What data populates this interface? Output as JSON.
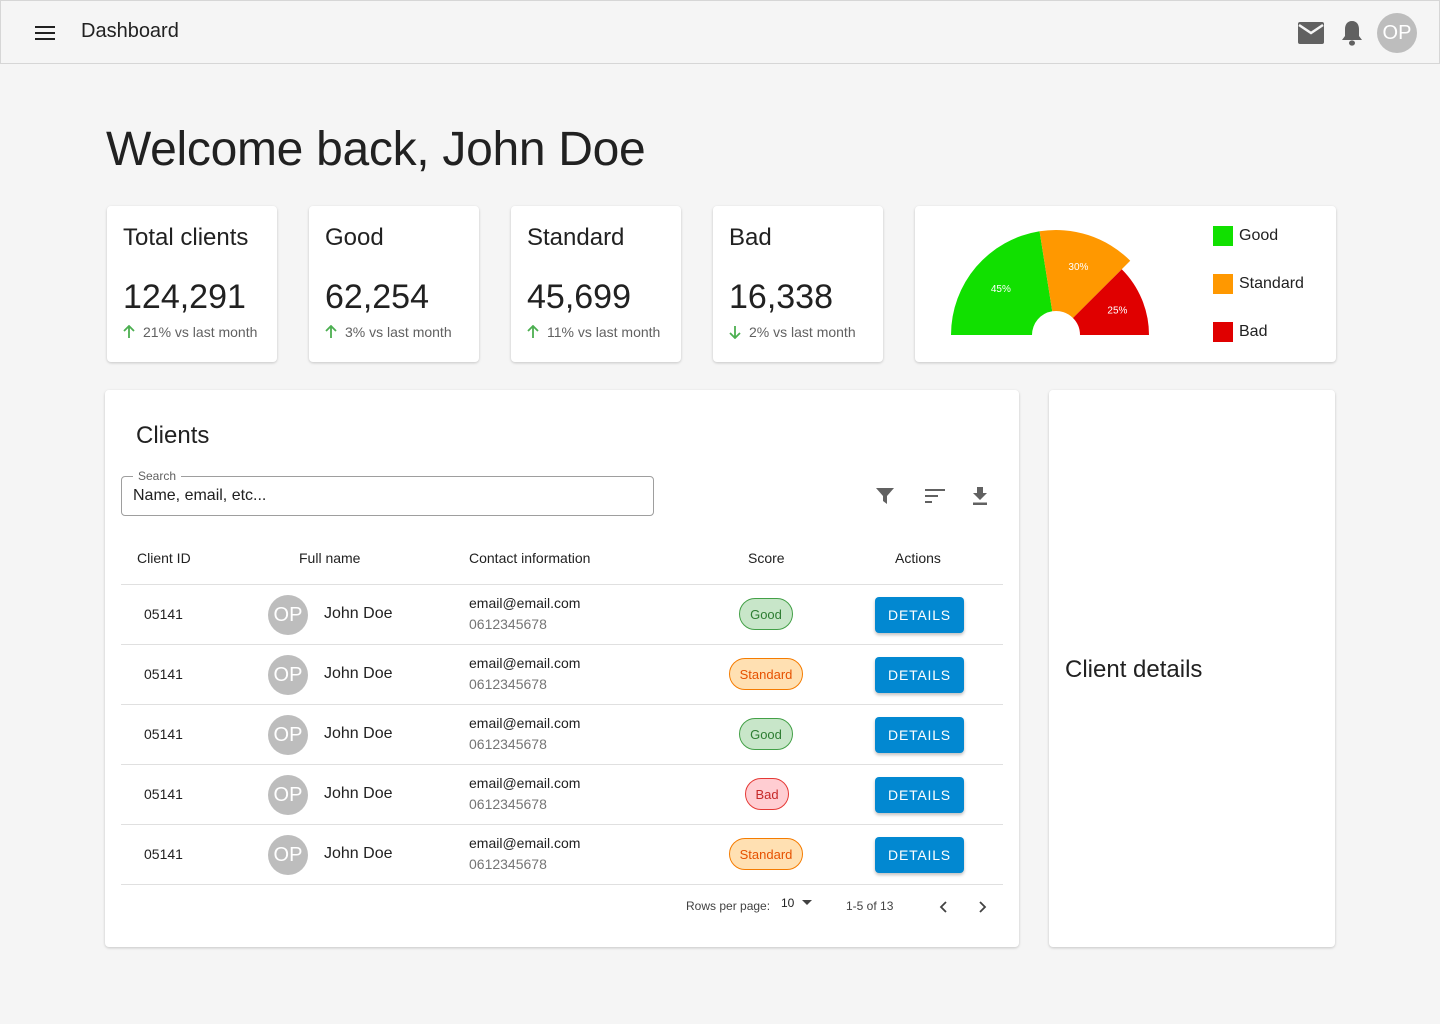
{
  "header": {
    "title": "Dashboard",
    "avatar_initials": "OP",
    "icons": [
      "menu-icon",
      "mail-icon",
      "bell-icon"
    ]
  },
  "welcome": "Welcome back, John Doe",
  "stats": [
    {
      "title": "Total clients",
      "value": "124,291",
      "trend": "21% vs last month",
      "direction": "up",
      "trend_color": "#4caf50"
    },
    {
      "title": "Good",
      "value": "62,254",
      "trend": "3% vs last month",
      "direction": "up",
      "trend_color": "#4caf50"
    },
    {
      "title": "Standard",
      "value": "45,699",
      "trend": "11% vs last month",
      "direction": "up",
      "trend_color": "#4caf50"
    },
    {
      "title": "Bad",
      "value": "16,338",
      "trend": "2% vs last month",
      "direction": "down",
      "trend_color": "#4caf50"
    }
  ],
  "chart_data": {
    "type": "pie",
    "variant": "half-donut",
    "categories": [
      "Good",
      "Standard",
      "Bad"
    ],
    "values": [
      45,
      30,
      25
    ],
    "labels": [
      "45%",
      "30%",
      "25%"
    ],
    "colors": [
      "#11e000",
      "#ff9800",
      "#e00000"
    ],
    "legend_position": "right"
  },
  "clients": {
    "title": "Clients",
    "search": {
      "label": "Search",
      "placeholder": "Name, email, etc..."
    },
    "tools": [
      "filter-icon",
      "sort-icon",
      "download-icon"
    ],
    "columns": [
      "Client ID",
      "Full name",
      "Contact information",
      "Score",
      "Actions"
    ],
    "rows": [
      {
        "id": "05141",
        "initials": "OP",
        "name": "John Doe",
        "email": "email@email.com",
        "phone": "0612345678",
        "score": "Good",
        "score_class": "good",
        "action": "DETAILS"
      },
      {
        "id": "05141",
        "initials": "OP",
        "name": "John Doe",
        "email": "email@email.com",
        "phone": "0612345678",
        "score": "Standard",
        "score_class": "standard",
        "action": "DETAILS"
      },
      {
        "id": "05141",
        "initials": "OP",
        "name": "John Doe",
        "email": "email@email.com",
        "phone": "0612345678",
        "score": "Good",
        "score_class": "good",
        "action": "DETAILS"
      },
      {
        "id": "05141",
        "initials": "OP",
        "name": "John Doe",
        "email": "email@email.com",
        "phone": "0612345678",
        "score": "Bad",
        "score_class": "bad",
        "action": "DETAILS"
      },
      {
        "id": "05141",
        "initials": "OP",
        "name": "John Doe",
        "email": "email@email.com",
        "phone": "0612345678",
        "score": "Standard",
        "score_class": "standard",
        "action": "DETAILS"
      }
    ],
    "pagination": {
      "rows_label": "Rows per page:",
      "rows_value": "10",
      "range": "1-5 of 13"
    }
  },
  "detail_panel": {
    "title": "Client details"
  },
  "accent_color": "#0288d1"
}
